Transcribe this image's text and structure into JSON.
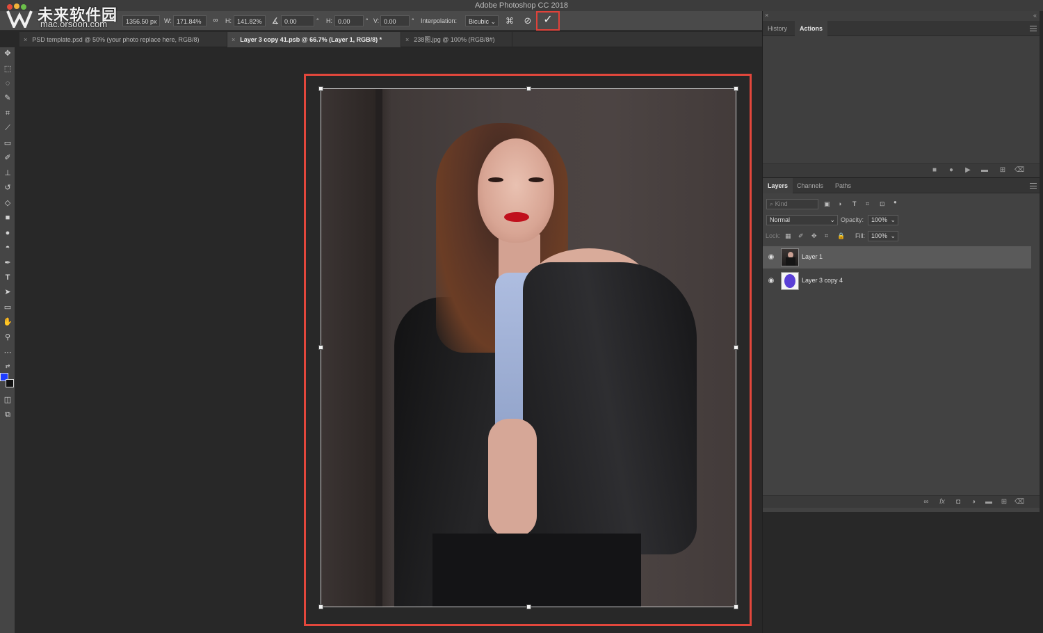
{
  "app": {
    "title": "Adobe Photoshop CC 2018"
  },
  "watermark": {
    "name_cn": "未来软件园",
    "url": "mac.orsoon.com"
  },
  "options_bar": {
    "x_value": "1356.50 px",
    "w_label": "W:",
    "w_value": "171.84%",
    "link_icon": "chain-link-icon",
    "h_label": "H:",
    "h_value": "141.82%",
    "angle_value": "0.00",
    "degree_symbol": "°",
    "hskew_label": "H:",
    "hskew_value": "0.00",
    "vskew_label": "V:",
    "vskew_value": "0.00",
    "interpolation_label": "Interpolation:",
    "interpolation_value": "Bicubic",
    "commit_symbol": "✓",
    "cancel_symbol": "⊘"
  },
  "tabs": [
    {
      "label": "PSD template.psd @ 50% (your photo replace here, RGB/8)",
      "active": false
    },
    {
      "label": "Layer 3 copy 41.psb @ 66.7% (Layer 1, RGB/8) *",
      "active": true
    },
    {
      "label": "238图.jpg @ 100% (RGB/8#)",
      "active": false
    }
  ],
  "colors": {
    "foreground": "#1d3cff",
    "background": "#111111",
    "highlight": "#e2473c"
  },
  "history_panel": {
    "tabs": [
      "History",
      "Actions"
    ],
    "active_tab": "Actions"
  },
  "layers_panel": {
    "tabs": [
      "Layers",
      "Channels",
      "Paths"
    ],
    "active_tab": "Layers",
    "filter_placeholder": "Kind",
    "blend_mode": "Normal",
    "opacity_label": "Opacity:",
    "opacity_value": "100%",
    "lock_label": "Lock:",
    "fill_label": "Fill:",
    "fill_value": "100%",
    "layers": [
      {
        "name": "Layer 1",
        "selected": true
      },
      {
        "name": "Layer 3 copy 4",
        "selected": false
      }
    ]
  }
}
